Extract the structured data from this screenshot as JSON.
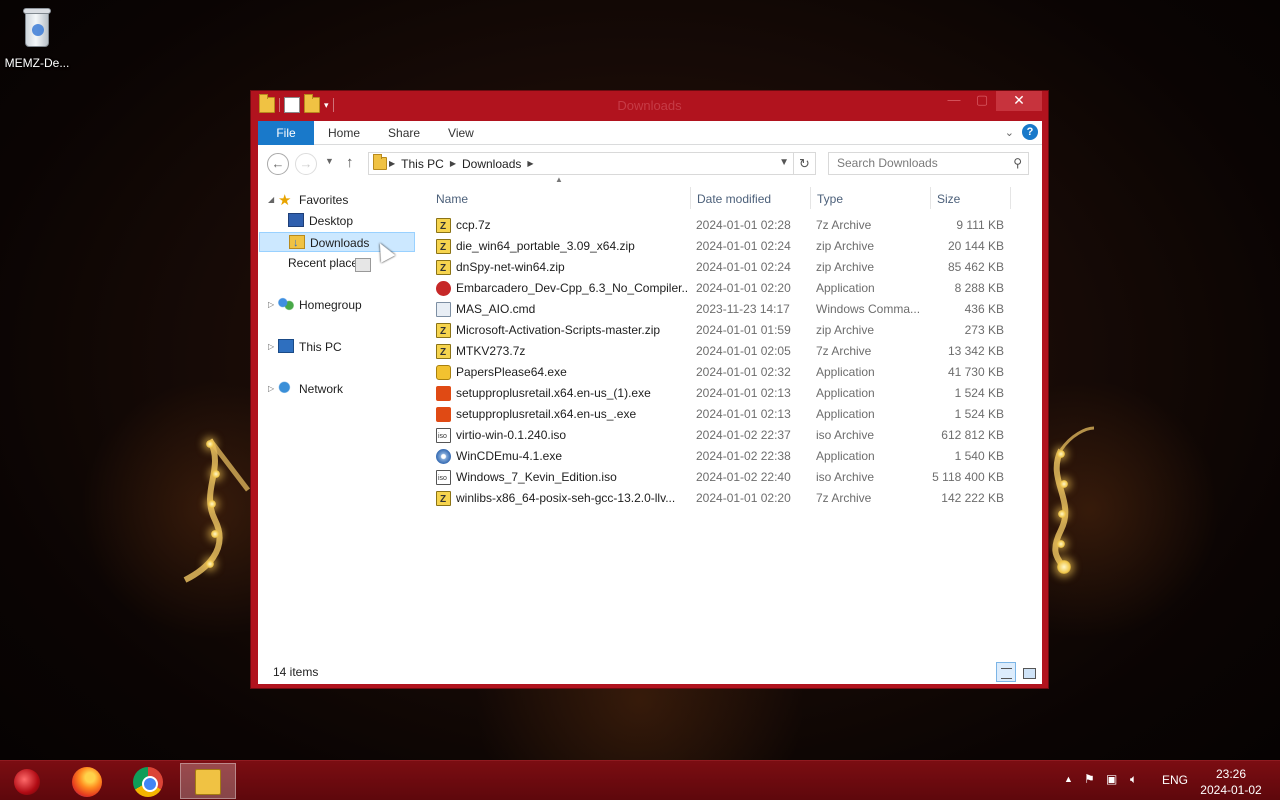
{
  "desktop": {
    "icon_label": "MEMZ-De..."
  },
  "window": {
    "title": "Downloads",
    "close_glyph": "✕",
    "min_glyph": "—",
    "max_glyph": "▢"
  },
  "ribbon": {
    "tabs": [
      "File",
      "Home",
      "Share",
      "View"
    ],
    "help_glyph": "?"
  },
  "address": {
    "crumbs": [
      "This PC",
      "Downloads"
    ],
    "search_placeholder": "Search Downloads"
  },
  "navpane": {
    "favorites": "Favorites",
    "desktop": "Desktop",
    "downloads": "Downloads",
    "recent": "Recent places",
    "homegroup": "Homegroup",
    "thispc": "This PC",
    "network": "Network"
  },
  "columns": {
    "name": "Name",
    "date": "Date modified",
    "type": "Type",
    "size": "Size"
  },
  "files": [
    {
      "name": "ccp.7z",
      "date": "2024-01-01 02:28",
      "type": "7z Archive",
      "size": "9 111 KB",
      "icon": "zip"
    },
    {
      "name": "die_win64_portable_3.09_x64.zip",
      "date": "2024-01-01 02:24",
      "type": "zip Archive",
      "size": "20 144 KB",
      "icon": "zip"
    },
    {
      "name": "dnSpy-net-win64.zip",
      "date": "2024-01-01 02:24",
      "type": "zip Archive",
      "size": "85 462 KB",
      "icon": "zip"
    },
    {
      "name": "Embarcadero_Dev-Cpp_6.3_No_Compiler...",
      "date": "2024-01-01 02:20",
      "type": "Application",
      "size": "8 288 KB",
      "icon": "app-red"
    },
    {
      "name": "MAS_AIO.cmd",
      "date": "2023-11-23 14:17",
      "type": "Windows Comma...",
      "size": "436 KB",
      "icon": "cmd"
    },
    {
      "name": "Microsoft-Activation-Scripts-master.zip",
      "date": "2024-01-01 01:59",
      "type": "zip Archive",
      "size": "273 KB",
      "icon": "zip"
    },
    {
      "name": "MTKV273.7z",
      "date": "2024-01-01 02:05",
      "type": "7z Archive",
      "size": "13 342 KB",
      "icon": "zip"
    },
    {
      "name": "PapersPlease64.exe",
      "date": "2024-01-01 02:32",
      "type": "Application",
      "size": "41 730 KB",
      "icon": "app-yel"
    },
    {
      "name": "setupproplusretail.x64.en-us_(1).exe",
      "date": "2024-01-01 02:13",
      "type": "Application",
      "size": "1 524 KB",
      "icon": "office"
    },
    {
      "name": "setupproplusretail.x64.en-us_.exe",
      "date": "2024-01-01 02:13",
      "type": "Application",
      "size": "1 524 KB",
      "icon": "office"
    },
    {
      "name": "virtio-win-0.1.240.iso",
      "date": "2024-01-02 22:37",
      "type": "iso Archive",
      "size": "612 812 KB",
      "icon": "iso"
    },
    {
      "name": "WinCDEmu-4.1.exe",
      "date": "2024-01-02 22:38",
      "type": "Application",
      "size": "1 540 KB",
      "icon": "disc"
    },
    {
      "name": "Windows_7_Kevin_Edition.iso",
      "date": "2024-01-02 22:40",
      "type": "iso Archive",
      "size": "5 118 400 KB",
      "icon": "iso"
    },
    {
      "name": "winlibs-x86_64-posix-seh-gcc-13.2.0-llv...",
      "date": "2024-01-01 02:20",
      "type": "7z Archive",
      "size": "142 222 KB",
      "icon": "zip"
    }
  ],
  "status": {
    "count": "14 items"
  },
  "taskbar": {
    "lang": "ENG",
    "time": "23:26",
    "date": "2024-01-02",
    "apps": [
      "start",
      "firefox",
      "chrome",
      "file-explorer"
    ]
  },
  "colors": {
    "window_frame": "#b1131e",
    "file_tab": "#1979ca",
    "selection": "#cce8ff",
    "taskbar": "#6e0a0f"
  }
}
